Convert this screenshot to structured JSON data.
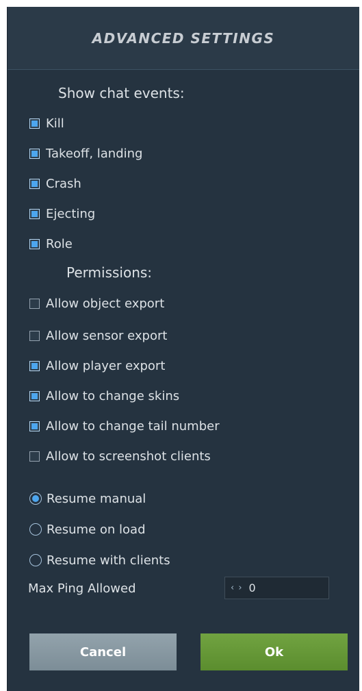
{
  "dialog": {
    "title": "ADVANCED SETTINGS"
  },
  "chat_events": {
    "title": "Show chat events:",
    "items": [
      {
        "label": "Kill",
        "checked": true
      },
      {
        "label": "Takeoff, landing",
        "checked": true
      },
      {
        "label": "Crash",
        "checked": true
      },
      {
        "label": "Ejecting",
        "checked": true
      },
      {
        "label": "Role",
        "checked": true
      }
    ]
  },
  "permissions": {
    "title": "Permissions:",
    "items": [
      {
        "label": "Allow object export",
        "checked": false
      },
      {
        "label": "Allow sensor export",
        "checked": false
      },
      {
        "label": "Allow player export",
        "checked": true
      },
      {
        "label": "Allow to change skins",
        "checked": true
      },
      {
        "label": "Allow to change tail number",
        "checked": true
      },
      {
        "label": "Allow to screenshot clients",
        "checked": false
      }
    ]
  },
  "resume": {
    "options": [
      {
        "label": "Resume manual",
        "selected": true
      },
      {
        "label": "Resume on load",
        "selected": false
      },
      {
        "label": "Resume with clients",
        "selected": false
      }
    ]
  },
  "max_ping": {
    "label": "Max Ping Allowed",
    "arrows": "‹ ›",
    "value": "0"
  },
  "buttons": {
    "cancel": "Cancel",
    "ok": "Ok"
  },
  "colors": {
    "panel_bg": "#253340",
    "checkbox_fill": "#4da6ee",
    "ok_green": "#6a9c3c",
    "cancel_gray": "#8797a0"
  }
}
